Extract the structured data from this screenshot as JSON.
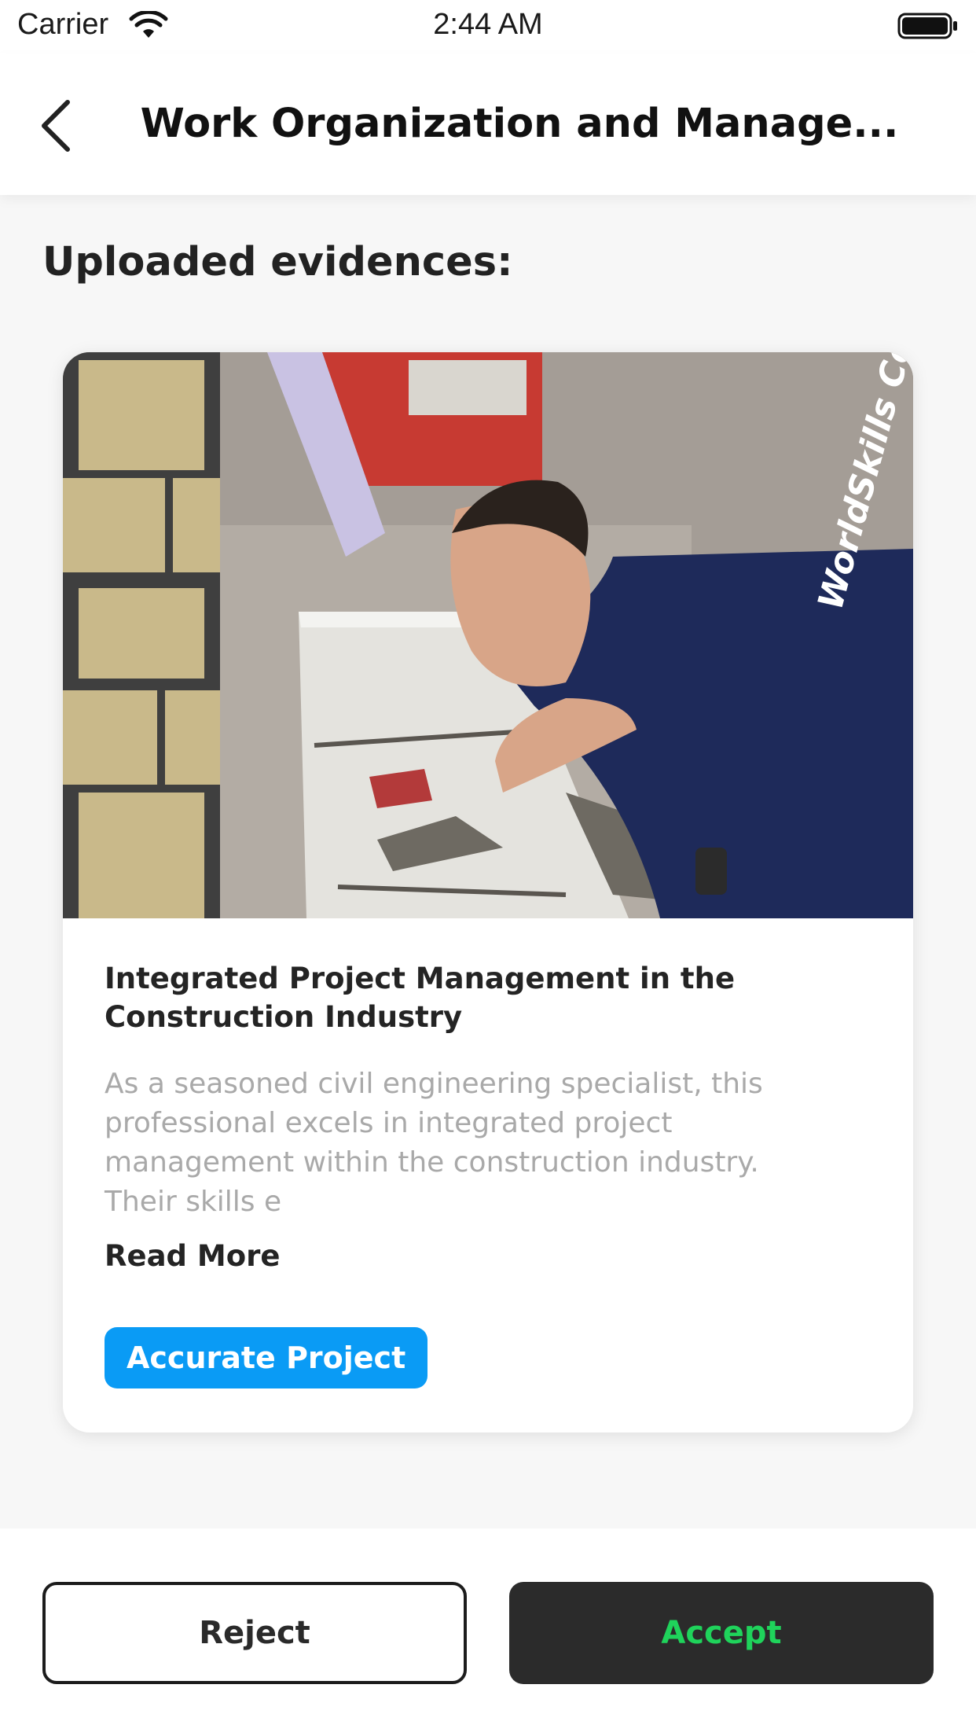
{
  "status_bar": {
    "carrier": "Carrier",
    "time": "2:44 AM"
  },
  "header": {
    "title": "Work Organization and Manage..."
  },
  "section": {
    "title": "Uploaded evidences:"
  },
  "evidence_card": {
    "title": "Integrated Project Management in the Construction Industry",
    "description": "As a seasoned civil engineering specialist, this\nprofessional excels in integrated project\nmanagement within the construction industry.\nTheir skills e",
    "read_more": "Read More",
    "tag": "Accurate Project",
    "photo_text": "WorldSkills Comp"
  },
  "actions": {
    "reject": "Reject",
    "accept": "Accept"
  },
  "colors": {
    "accent": "#0a9bf5",
    "accept_text": "#1fd35b",
    "accept_bg": "#2b2b2b"
  }
}
